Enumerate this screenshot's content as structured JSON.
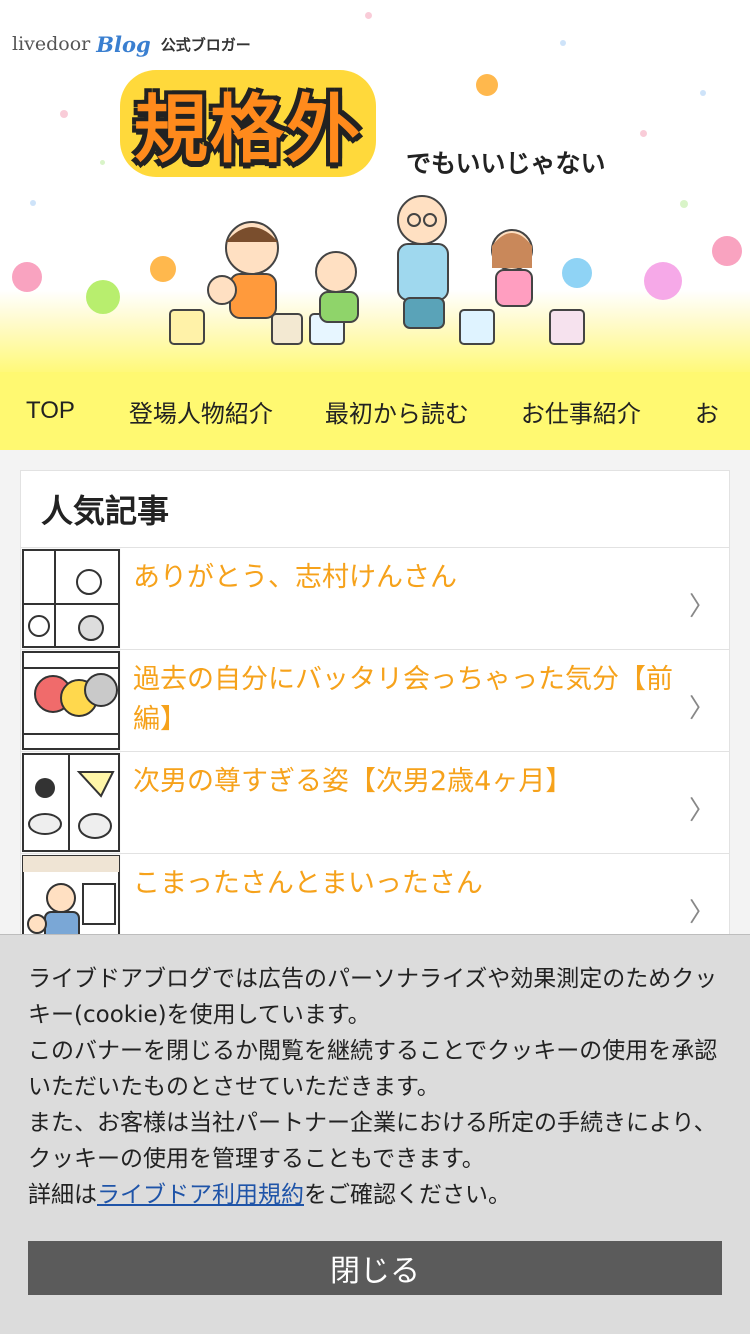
{
  "brand": {
    "livedoor": "livedoor",
    "blog": "Blog",
    "badge": "公式ブロガー"
  },
  "logo": {
    "title": "規格外",
    "subtitle": "でもいいじゃない"
  },
  "nav": {
    "items": [
      {
        "label": "TOP"
      },
      {
        "label": "登場人物紹介"
      },
      {
        "label": "最初から読む"
      },
      {
        "label": "お仕事紹介"
      },
      {
        "label": "お"
      }
    ]
  },
  "popular": {
    "heading": "人気記事",
    "articles": [
      {
        "title": "ありがとう、志村けんさん"
      },
      {
        "title": "過去の自分にバッタリ会っちゃった気分【前編】"
      },
      {
        "title": "次男の尊すぎる姿【次男2歳4ヶ月】"
      },
      {
        "title": "こまったさんとまいったさん"
      }
    ]
  },
  "cookie": {
    "line1": "ライブドアブログでは広告のパーソナライズや効果測定のためクッキー(cookie)を使用しています。",
    "line2": "このバナーを閉じるか閲覧を継続することでクッキーの使用を承認いただいたものとさせていただきます。",
    "line3": "また、お客様は当社パートナー企業における所定の手続きにより、クッキーの使用を管理することもできます。",
    "detail_prefix": "詳細は",
    "detail_link": "ライブドア利用規約",
    "detail_suffix": "をご確認ください。",
    "close_label": "閉じる"
  },
  "colors": {
    "nav_bg": "#fff971",
    "article_title": "#f6a21b",
    "close_button": "#5b5b5b",
    "link": "#1f54a8",
    "logo_orange": "#ff8a1c"
  }
}
